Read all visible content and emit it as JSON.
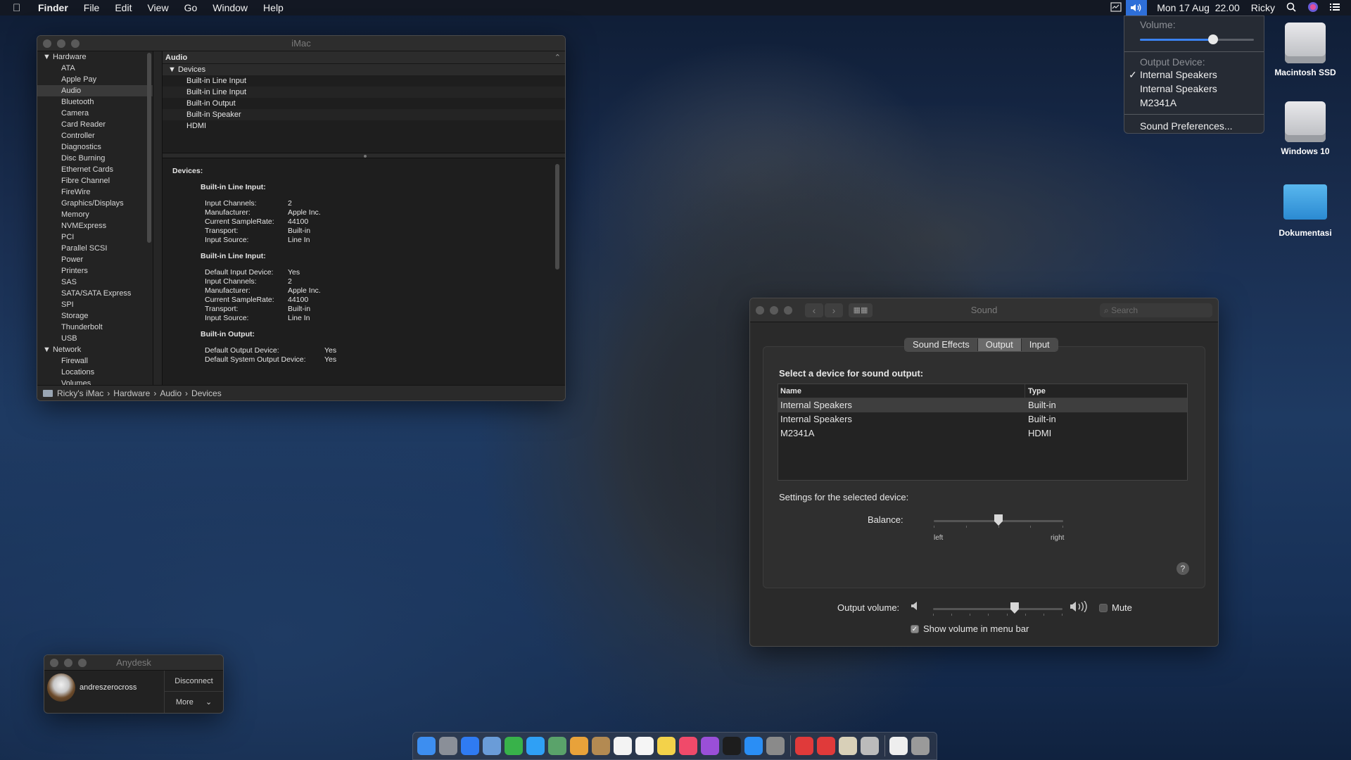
{
  "menubar": {
    "apple": "",
    "app": "Finder",
    "items": [
      "File",
      "Edit",
      "View",
      "Go",
      "Window",
      "Help"
    ],
    "datetime": "Mon 17 Aug  22.00",
    "user": "Ricky"
  },
  "volume_menu": {
    "volume_label": "Volume:",
    "volume_level": 0.65,
    "output_device_label": "Output Device:",
    "devices": [
      "Internal Speakers",
      "Internal Speakers",
      "M2341A"
    ],
    "checked_index": 0,
    "sound_prefs": "Sound Preferences..."
  },
  "desktop": {
    "icons": [
      "Macintosh SSD",
      "Windows 10",
      "Dokumentasi"
    ]
  },
  "sysinfo": {
    "title": "iMac",
    "sidebar": {
      "hardware_label": "Hardware",
      "hardware_items": [
        "ATA",
        "Apple Pay",
        "Audio",
        "Bluetooth",
        "Camera",
        "Card Reader",
        "Controller",
        "Diagnostics",
        "Disc Burning",
        "Ethernet Cards",
        "Fibre Channel",
        "FireWire",
        "Graphics/Displays",
        "Memory",
        "NVMExpress",
        "PCI",
        "Parallel SCSI",
        "Power",
        "Printers",
        "SAS",
        "SATA/SATA Express",
        "SPI",
        "Storage",
        "Thunderbolt",
        "USB"
      ],
      "network_label": "Network",
      "network_items": [
        "Firewall",
        "Locations",
        "Volumes"
      ]
    },
    "header": "Audio",
    "devices_label": "Devices",
    "device_list": [
      "Built-in Line Input",
      "Built-in Line Input",
      "Built-in Output",
      "Built-in Speaker",
      "HDMI"
    ],
    "details": {
      "heading": "Devices:",
      "dev1": {
        "title": "Built-in Line Input:",
        "rows": [
          [
            "Input Channels:",
            "2"
          ],
          [
            "Manufacturer:",
            "Apple Inc."
          ],
          [
            "Current SampleRate:",
            "44100"
          ],
          [
            "Transport:",
            "Built-in"
          ],
          [
            "Input Source:",
            "Line In"
          ]
        ]
      },
      "dev2": {
        "title": "Built-in Line Input:",
        "rows": [
          [
            "Default Input Device:",
            "Yes"
          ],
          [
            "Input Channels:",
            "2"
          ],
          [
            "Manufacturer:",
            "Apple Inc."
          ],
          [
            "Current SampleRate:",
            "44100"
          ],
          [
            "Transport:",
            "Built-in"
          ],
          [
            "Input Source:",
            "Line In"
          ]
        ]
      },
      "dev3": {
        "title": "Built-in Output:",
        "rows": [
          [
            "Default Output Device:",
            "Yes"
          ],
          [
            "Default System Output Device:",
            "Yes"
          ]
        ]
      }
    },
    "path": [
      "Ricky's iMac",
      "Hardware",
      "Audio",
      "Devices"
    ],
    "path_sep": "›"
  },
  "sound": {
    "title": "Sound",
    "search_placeholder": "Search",
    "tabs": [
      "Sound Effects",
      "Output",
      "Input"
    ],
    "active_tab": 1,
    "select_label": "Select a device for sound output:",
    "col_name": "Name",
    "col_type": "Type",
    "rows": [
      [
        "Internal Speakers",
        "Built-in"
      ],
      [
        "Internal Speakers",
        "Built-in"
      ],
      [
        "M2341A",
        "HDMI"
      ]
    ],
    "selected_row": 0,
    "settings_label": "Settings for the selected device:",
    "balance_label": "Balance:",
    "balance_value": 0.5,
    "left_label": "left",
    "right_label": "right",
    "help": "?",
    "output_volume_label": "Output volume:",
    "output_volume": 0.63,
    "mute_label": "Mute",
    "mute_checked": false,
    "show_volume_label": "Show volume in menu bar",
    "show_volume_checked": true
  },
  "anydesk": {
    "title": "Anydesk",
    "user": "andreszerocross",
    "disconnect": "Disconnect",
    "more": "More"
  },
  "dock": {
    "icons": [
      "finder-icon",
      "launchpad-icon",
      "safari-icon",
      "mail-icon",
      "facetime-icon",
      "messages-icon",
      "maps-icon",
      "photos-icon",
      "contacts-icon",
      "calendar-icon",
      "reminders-icon",
      "notes-icon",
      "music-icon",
      "podcasts-icon",
      "tv-icon",
      "app-store-icon",
      "system-preferences-icon",
      "anydesk-icon",
      "anydesk-alt-icon",
      "preview-icon",
      "script-editor-icon",
      "document-icon",
      "trash-icon"
    ],
    "colors": [
      "#3d8ef0",
      "#8a8f98",
      "#2f7bf2",
      "#6a9cd8",
      "#38b24a",
      "#2fa0f5",
      "#5aa36a",
      "#e8a23a",
      "#b38a52",
      "#f3f3f3",
      "#f5f5f5",
      "#f3d24a",
      "#f04a6a",
      "#9a4fd8",
      "#1d1d1d",
      "#2a8ef5",
      "#8a8a8a",
      "#e03a3a",
      "#e03a3a",
      "#d8d0b8",
      "#bbbbbb",
      "#eeeeee",
      "#9a9a9a"
    ]
  }
}
